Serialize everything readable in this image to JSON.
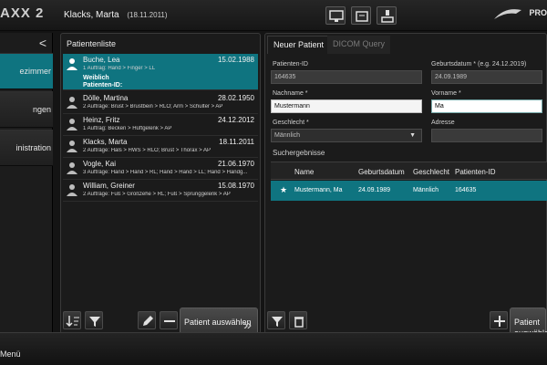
{
  "app": {
    "brand": "AXX 2",
    "logo_text": "PRO"
  },
  "current_patient": {
    "name": "Klacks, Marta",
    "date": "(18.11.2011)"
  },
  "top_icons": [
    "monitor-icon",
    "archive-icon",
    "scanner-icon"
  ],
  "left_nav": {
    "collapse": "<",
    "items": [
      {
        "label": "ezimmer",
        "active": true
      },
      {
        "label": "ngen",
        "active": false
      },
      {
        "label": "inistration",
        "active": false
      }
    ]
  },
  "patient_list": {
    "title": "Patientenliste",
    "rows": [
      {
        "name": "Buche, Lea",
        "date": "15.02.1988",
        "sub": "1 Auftrag: Hand > Finger > LL",
        "extra1": "Weiblich",
        "extra2": "Patienten-ID:",
        "selected": true
      },
      {
        "name": "Dölle, Martina",
        "date": "28.02.1950",
        "sub": "2 Aufträge: Brust > Brustbein > RLO; Arm > Schulter > AP"
      },
      {
        "name": "Heinz, Fritz",
        "date": "24.12.2012",
        "sub": "1 Auftrag: Becken > Hüftgelenk > AP"
      },
      {
        "name": "Klacks, Marta",
        "date": "18.11.2011",
        "sub": "2 Aufträge: Hals > HWS > RLO; Brust > Thorax > AP"
      },
      {
        "name": "Vogle, Kai",
        "date": "21.06.1970",
        "sub": "3 Aufträge: Hand > Hand > RL; Hand > Hand > LL; Hand > Handg..."
      },
      {
        "name": "William, Greiner",
        "date": "15.08.1970",
        "sub": "2 Aufträge: Fuß > Großzehe > RL; Fuß > Sprunggelenk > AP"
      }
    ],
    "select_button": "Patient auswählen"
  },
  "new_patient": {
    "tabs": [
      "Neuer Patient",
      "DICOM Query"
    ],
    "labels": {
      "patient_id": "Patienten-ID",
      "birthdate": "Geburtsdatum *",
      "birthdate_hint": "(e.g. 24.12.2019)",
      "lastname": "Nachname *",
      "firstname": "Vorname *",
      "gender": "Geschlecht *",
      "address": "Adresse"
    },
    "values": {
      "patient_id": "164635",
      "birthdate": "24.09.1989",
      "lastname": "Mustermann",
      "firstname": "Ma",
      "gender": "Männlich",
      "address": ""
    },
    "results_title": "Suchergebnisse",
    "columns": [
      "Name",
      "Geburtsdatum",
      "Geschlecht",
      "Patienten-ID"
    ],
    "results": [
      {
        "name": "Mustermann, Ma",
        "birthdate": "24.09.1989",
        "gender": "Männlich",
        "id": "164635"
      }
    ],
    "select_button": "Patient auswählen"
  },
  "bottom": {
    "menu": "Menü"
  }
}
